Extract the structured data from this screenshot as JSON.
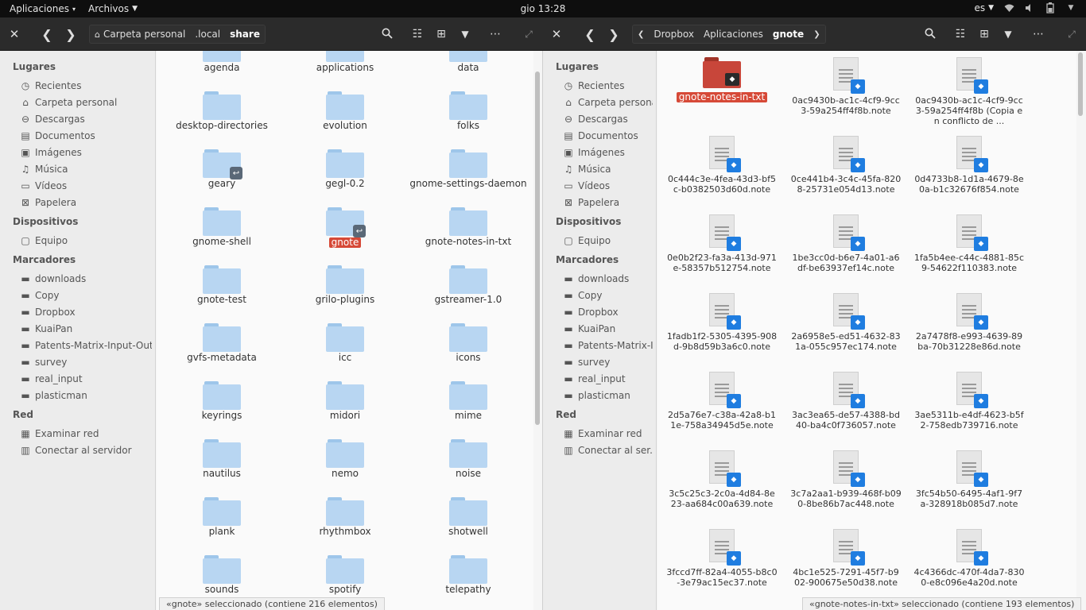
{
  "topbar": {
    "apps_menu": "Aplicaciones",
    "files_menu": "Archivos",
    "clock": "gio 13:28",
    "keyboard_layout": "es",
    "indicators": [
      "wifi-icon",
      "volume-icon",
      "battery-icon",
      "power-icon"
    ]
  },
  "left": {
    "breadcrumbs": [
      "Carpeta personal",
      ".local",
      "share"
    ],
    "status": "«gnote» seleccionado  (contiene 216 elementos)",
    "items": [
      {
        "label": "agenda",
        "emblem": ""
      },
      {
        "label": "applications",
        "emblem": ""
      },
      {
        "label": "data",
        "emblem": ""
      },
      {
        "label": "desktop-directories",
        "emblem": ""
      },
      {
        "label": "evolution",
        "emblem": ""
      },
      {
        "label": "folks",
        "emblem": ""
      },
      {
        "label": "geary",
        "emblem": "link"
      },
      {
        "label": "gegl-0.2",
        "emblem": ""
      },
      {
        "label": "gnome-settings-daemon",
        "emblem": ""
      },
      {
        "label": "gnome-shell",
        "emblem": ""
      },
      {
        "label": "gnote",
        "emblem": "link",
        "selected": true
      },
      {
        "label": "gnote-notes-in-txt",
        "emblem": ""
      },
      {
        "label": "gnote-test",
        "emblem": ""
      },
      {
        "label": "grilo-plugins",
        "emblem": ""
      },
      {
        "label": "gstreamer-1.0",
        "emblem": ""
      },
      {
        "label": "gvfs-metadata",
        "emblem": ""
      },
      {
        "label": "icc",
        "emblem": ""
      },
      {
        "label": "icons",
        "emblem": ""
      },
      {
        "label": "keyrings",
        "emblem": ""
      },
      {
        "label": "midori",
        "emblem": ""
      },
      {
        "label": "mime",
        "emblem": ""
      },
      {
        "label": "nautilus",
        "emblem": ""
      },
      {
        "label": "nemo",
        "emblem": ""
      },
      {
        "label": "noise",
        "emblem": ""
      },
      {
        "label": "plank",
        "emblem": ""
      },
      {
        "label": "rhythmbox",
        "emblem": ""
      },
      {
        "label": "shotwell",
        "emblem": ""
      },
      {
        "label": "sounds",
        "emblem": ""
      },
      {
        "label": "spotify",
        "emblem": ""
      },
      {
        "label": "telepathy",
        "emblem": ""
      }
    ]
  },
  "right": {
    "breadcrumbs": [
      "Dropbox",
      "Aplicaciones",
      "gnote"
    ],
    "status": "«gnote-notes-in-txt» seleccionado  (contiene 193 elementos)",
    "items": [
      {
        "label": "gnote-notes-in-txt",
        "type": "folder",
        "selected": true
      },
      {
        "label": "0ac9430b-ac1c-4cf9-9cc3-59a254ff4f8b.note",
        "type": "note"
      },
      {
        "label": "0ac9430b-ac1c-4cf9-9cc3-59a254ff4f8b (Copia en conflicto de ...",
        "type": "note"
      },
      {
        "label": "0c444c3e-4fea-43d3-bf5c-b0382503d60d.note",
        "type": "note"
      },
      {
        "label": "0ce441b4-3c4c-45fa-8208-25731e054d13.note",
        "type": "note"
      },
      {
        "label": "0d4733b8-1d1a-4679-8e0a-b1c32676f854.note",
        "type": "note"
      },
      {
        "label": "0e0b2f23-fa3a-413d-971e-58357b512754.note",
        "type": "note"
      },
      {
        "label": "1be3cc0d-b6e7-4a01-a6df-be63937ef14c.note",
        "type": "note"
      },
      {
        "label": "1fa5b4ee-c44c-4881-85c9-54622f110383.note",
        "type": "note"
      },
      {
        "label": "1fadb1f2-5305-4395-908d-9b8d59b3a6c0.note",
        "type": "note"
      },
      {
        "label": "2a6958e5-ed51-4632-831a-055c957ec174.note",
        "type": "note"
      },
      {
        "label": "2a7478f8-e993-4639-89ba-70b31228e86d.note",
        "type": "note"
      },
      {
        "label": "2d5a76e7-c38a-42a8-b11e-758a34945d5e.note",
        "type": "note"
      },
      {
        "label": "3ac3ea65-de57-4388-bd40-ba4c0f736057.note",
        "type": "note"
      },
      {
        "label": "3ae5311b-e4df-4623-b5f2-758edb739716.note",
        "type": "note"
      },
      {
        "label": "3c5c25c3-2c0a-4d84-8e23-aa684c00a639.note",
        "type": "note"
      },
      {
        "label": "3c7a2aa1-b939-468f-b090-8be86b7ac448.note",
        "type": "note"
      },
      {
        "label": "3fc54b50-6495-4af1-9f7a-328918b085d7.note",
        "type": "note"
      },
      {
        "label": "3fccd7ff-82a4-4055-b8c0-3e79ac15ec37.note",
        "type": "note"
      },
      {
        "label": "4bc1e525-7291-45f7-b902-900675e50d38.note",
        "type": "note"
      },
      {
        "label": "4c4366dc-470f-4da7-8300-e8c096e4a20d.note",
        "type": "note"
      }
    ]
  },
  "sidebar_left": {
    "sections": [
      {
        "title": "Lugares",
        "items": [
          {
            "label": "Recientes",
            "icon": "clock-icon"
          },
          {
            "label": "Carpeta personal",
            "icon": "home-icon"
          },
          {
            "label": "Descargas",
            "icon": "download-icon"
          },
          {
            "label": "Documentos",
            "icon": "document-icon"
          },
          {
            "label": "Imágenes",
            "icon": "image-icon"
          },
          {
            "label": "Música",
            "icon": "music-icon"
          },
          {
            "label": "Vídeos",
            "icon": "video-icon"
          },
          {
            "label": "Papelera",
            "icon": "trash-icon"
          }
        ]
      },
      {
        "title": "Dispositivos",
        "items": [
          {
            "label": "Equipo",
            "icon": "computer-icon"
          }
        ]
      },
      {
        "title": "Marcadores",
        "items": [
          {
            "label": "downloads",
            "icon": "folder-icon"
          },
          {
            "label": "Copy",
            "icon": "folder-icon"
          },
          {
            "label": "Dropbox",
            "icon": "folder-icon"
          },
          {
            "label": "KuaiPan",
            "icon": "folder-icon"
          },
          {
            "label": "Patents-Matrix-Input-Out...",
            "icon": "folder-icon"
          },
          {
            "label": "survey",
            "icon": "folder-icon"
          },
          {
            "label": "real_input",
            "icon": "folder-icon"
          },
          {
            "label": "plasticman",
            "icon": "folder-icon"
          }
        ]
      },
      {
        "title": "Red",
        "items": [
          {
            "label": "Examinar red",
            "icon": "network-icon"
          },
          {
            "label": "Conectar al servidor",
            "icon": "server-icon"
          }
        ]
      }
    ]
  },
  "sidebar_right": {
    "sections": [
      {
        "title": "Lugares",
        "items": [
          {
            "label": "Recientes",
            "icon": "clock-icon"
          },
          {
            "label": "Carpeta personal",
            "icon": "home-icon"
          },
          {
            "label": "Descargas",
            "icon": "download-icon"
          },
          {
            "label": "Documentos",
            "icon": "document-icon"
          },
          {
            "label": "Imágenes",
            "icon": "image-icon"
          },
          {
            "label": "Música",
            "icon": "music-icon"
          },
          {
            "label": "Vídeos",
            "icon": "video-icon"
          },
          {
            "label": "Papelera",
            "icon": "trash-icon"
          }
        ]
      },
      {
        "title": "Dispositivos",
        "items": [
          {
            "label": "Equipo",
            "icon": "computer-icon"
          }
        ]
      },
      {
        "title": "Marcadores",
        "items": [
          {
            "label": "downloads",
            "icon": "folder-icon"
          },
          {
            "label": "Copy",
            "icon": "folder-icon"
          },
          {
            "label": "Dropbox",
            "icon": "folder-icon"
          },
          {
            "label": "KuaiPan",
            "icon": "folder-icon"
          },
          {
            "label": "Patents-Matrix-I...",
            "icon": "folder-icon"
          },
          {
            "label": "survey",
            "icon": "folder-icon"
          },
          {
            "label": "real_input",
            "icon": "folder-icon"
          },
          {
            "label": "plasticman",
            "icon": "folder-icon"
          }
        ]
      },
      {
        "title": "Red",
        "items": [
          {
            "label": "Examinar red",
            "icon": "network-icon"
          },
          {
            "label": "Conectar al ser...",
            "icon": "server-icon"
          }
        ]
      }
    ]
  },
  "colors": {
    "selection": "#d64937",
    "folder": "#b8d6f2",
    "headerbar": "#2b2b2b",
    "dropbox": "#1f7de0"
  }
}
